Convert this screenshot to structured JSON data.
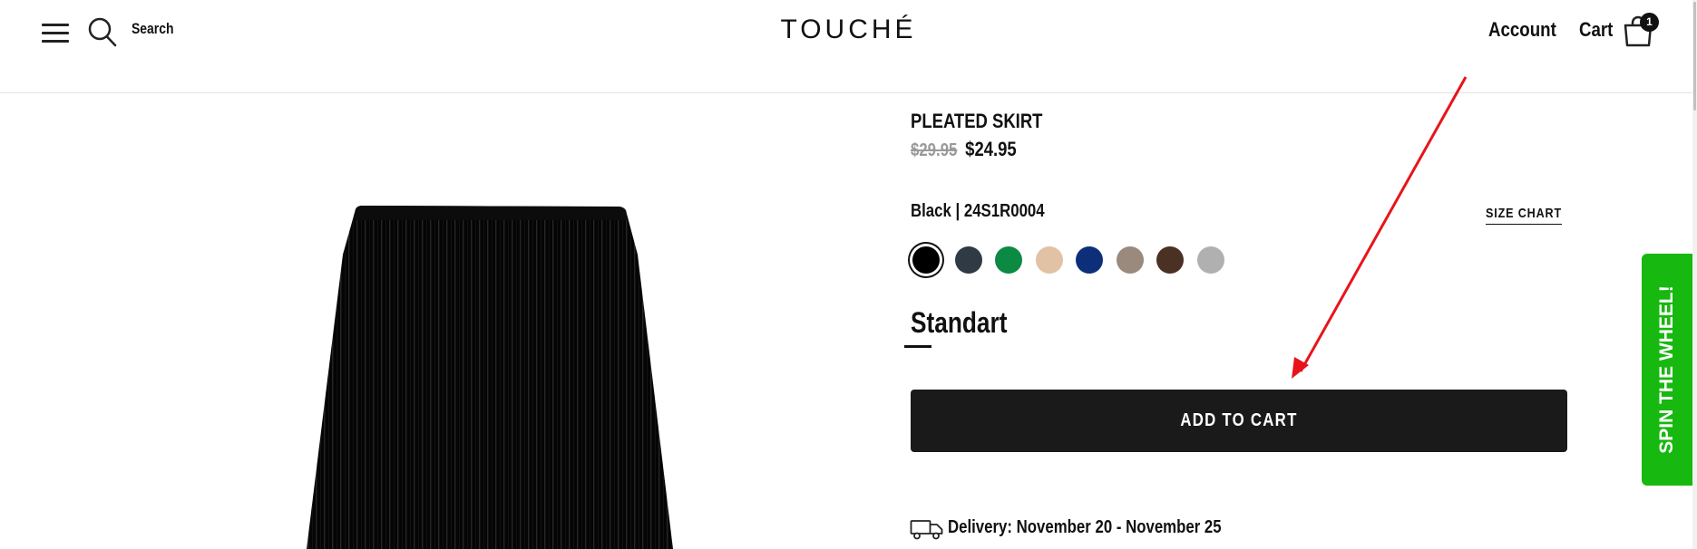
{
  "header": {
    "search_label": "Search",
    "logo": "TOUCHÉ",
    "account_label": "Account",
    "cart_label": "Cart",
    "cart_count": "1"
  },
  "product": {
    "title": "PLEATED SKIRT",
    "price_old": "$29.95",
    "price_new": "$24.95",
    "variant_label": "Black | 24S1R0004",
    "size_chart_label": "SIZE CHART",
    "swatches": [
      {
        "color": "#000000",
        "selected": true
      },
      {
        "color": "#2f3a44"
      },
      {
        "color": "#0c8a43"
      },
      {
        "color": "#e2c2a4"
      },
      {
        "color": "#0d2f7a"
      },
      {
        "color": "#9a8a7d"
      },
      {
        "color": "#4a3124"
      },
      {
        "color": "#b0b0b0"
      }
    ],
    "size_option": "Standart",
    "add_to_cart_label": "ADD TO CART",
    "delivery_text": "Delivery: November 20 - November 25"
  },
  "promo": {
    "spin_label": "SPIN THE WHEEL!",
    "color": "#17b80f"
  },
  "annotation": {
    "arrow_color": "#e8141b"
  }
}
